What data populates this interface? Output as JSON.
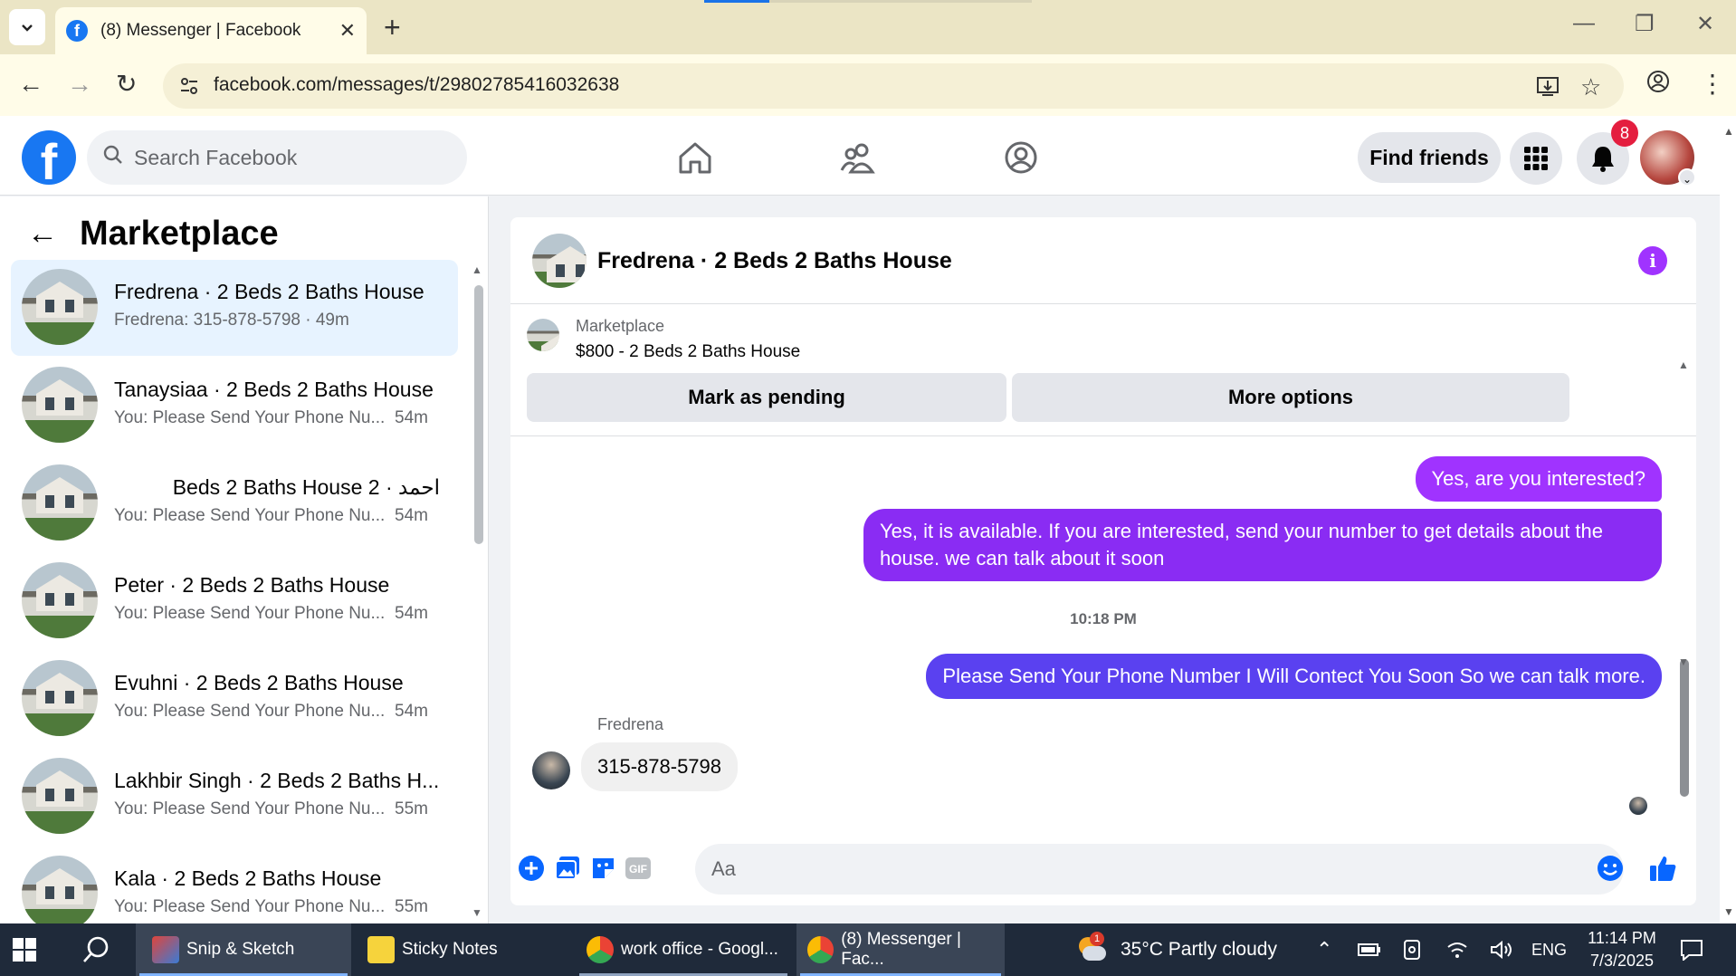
{
  "browser": {
    "tab_title": "(8) Messenger | Facebook",
    "url": "facebook.com/messages/t/29802785416032638"
  },
  "fb": {
    "search_placeholder": "Search Facebook",
    "find_friends": "Find friends",
    "notification_count": "8"
  },
  "sidebar": {
    "title": "Marketplace",
    "conversations": [
      {
        "name": "Fredrena · 2 Beds 2 Baths House",
        "snippet": "Fredrena: 315-878-5798 · 49m",
        "time": "",
        "active": true
      },
      {
        "name": "Tanaysiaa · 2 Beds 2 Baths House",
        "snippet": "You: Please Send Your Phone Nu...",
        "time": "54m"
      },
      {
        "name": "احمد · 2 Beds 2 Baths House",
        "snippet": "You: Please Send Your Phone Nu...",
        "time": "54m"
      },
      {
        "name": "Peter · 2 Beds 2 Baths House",
        "snippet": "You: Please Send Your Phone Nu...",
        "time": "54m"
      },
      {
        "name": "Evuhni · 2 Beds 2 Baths House",
        "snippet": "You: Please Send Your Phone Nu...",
        "time": "54m"
      },
      {
        "name": "Lakhbir Singh · 2 Beds 2 Baths H...",
        "snippet": "You: Please Send Your Phone Nu...",
        "time": "55m"
      },
      {
        "name": "Kala · 2 Beds 2 Baths House",
        "snippet": "You: Please Send Your Phone Nu...",
        "time": "55m"
      }
    ]
  },
  "chat": {
    "title": "Fredrena · 2 Beds 2 Baths House",
    "listing_label": "Marketplace",
    "listing_price": "$800 - 2 Beds 2 Baths House",
    "mark_pending": "Mark as pending",
    "more_options": "More options",
    "messages": {
      "m1": "Yes, are you interested?",
      "m2": "Yes, it is available. If you are interested, send your number to get details about the house. we can talk about it soon",
      "timestamp": "10:18 PM",
      "m3": "Please Send Your Phone Number I Will Contect You Soon So we can talk more.",
      "sender": "Fredrena",
      "m4": "315-878-5798"
    },
    "composer_placeholder": "Aa",
    "gif_label": "GIF"
  },
  "taskbar": {
    "snip": "Snip & Sketch",
    "sticky": "Sticky Notes",
    "chrome1": "work office - Googl...",
    "chrome2": "(8) Messenger | Fac...",
    "weather": "35°C  Partly cloudy",
    "lang": "ENG",
    "time": "11:14 PM",
    "date": "7/3/2025",
    "weather_badge": "1"
  },
  "colors": {
    "fb_blue": "#1877f2",
    "bubble_purple": "#a033ff",
    "bubble_violet": "#8a2cf3",
    "bubble_blue": "#5a41f0",
    "active_row": "#e7f3ff"
  }
}
